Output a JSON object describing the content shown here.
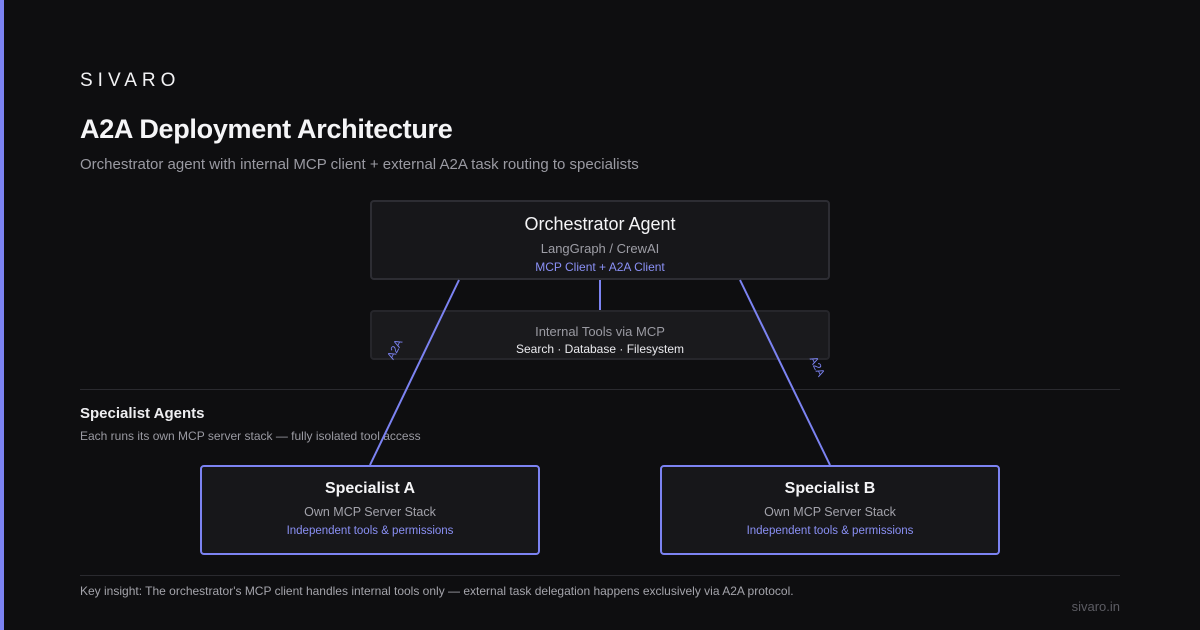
{
  "brand": "SIVARO",
  "title": "A2A Deployment Architecture",
  "subtitle": "Orchestrator agent with internal MCP client + external A2A task routing to specialists",
  "orchestrator": {
    "title": "Orchestrator Agent",
    "subtitle": "LangGraph / CrewAI",
    "accent": "MCP Client + A2A Client"
  },
  "internal_tools": {
    "title": "Internal Tools via MCP",
    "items": "Search · Database · Filesystem"
  },
  "connections": {
    "left_label": "A2A",
    "right_label": "A2A"
  },
  "specialists_section": {
    "title": "Specialist Agents",
    "description": "Each runs its own MCP server stack — fully isolated tool access"
  },
  "specialists": [
    {
      "title": "Specialist A",
      "subtitle": "Own MCP Server Stack",
      "accent": "Independent tools & permissions"
    },
    {
      "title": "Specialist B",
      "subtitle": "Own MCP Server Stack",
      "accent": "Independent tools & permissions"
    }
  ],
  "key_insight": "Key insight: The orchestrator's MCP client handles internal tools only — external task delegation happens exclusively via A2A protocol.",
  "footer_domain": "sivaro.in",
  "colors": {
    "accent": "#7c83f2",
    "background": "#0e0e10",
    "box": "#17171a"
  }
}
